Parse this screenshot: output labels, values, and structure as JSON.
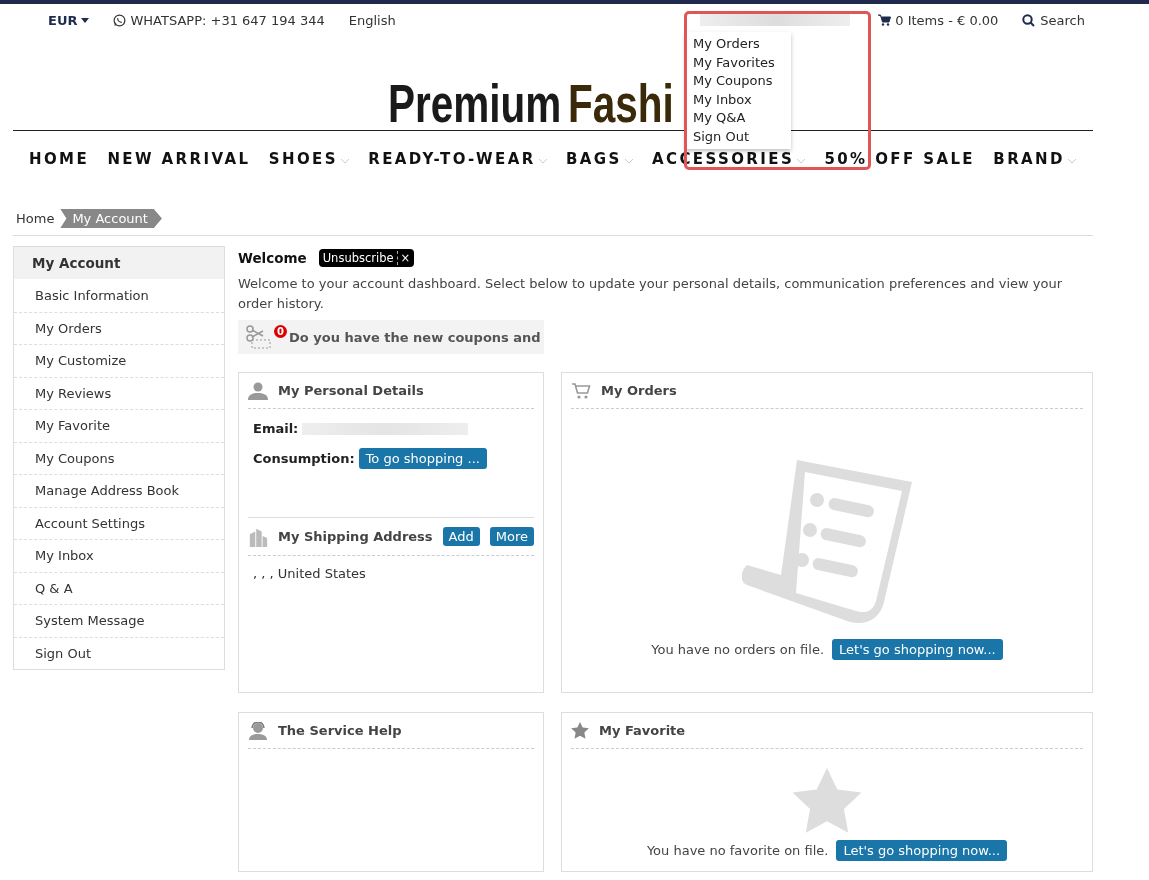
{
  "topbar": {
    "currency": "EUR",
    "whatsapp": "WHATSAPP: +31 647 194 344",
    "language": "English",
    "cart": "0 Items - € 0.00",
    "search": "Search"
  },
  "account_menu": {
    "items": [
      "My Orders",
      "My Favorites",
      "My Coupons",
      "My Inbox",
      "My Q&A",
      "Sign Out"
    ]
  },
  "logo": {
    "part_1": "Premium",
    "part_2": "Fashi"
  },
  "nav": [
    {
      "label": "HOME",
      "has_menu": false
    },
    {
      "label": "NEW ARRIVAL",
      "has_menu": false
    },
    {
      "label": "SHOES",
      "has_menu": true
    },
    {
      "label": "READY-TO-WEAR",
      "has_menu": true
    },
    {
      "label": "BAGS",
      "has_menu": true
    },
    {
      "label": "ACCESSORIES",
      "has_menu": true
    },
    {
      "label": "50% OFF SALE",
      "has_menu": false
    },
    {
      "label": "BRAND",
      "has_menu": true
    }
  ],
  "breadcrumb": [
    "Home",
    "My Account"
  ],
  "sidebar": {
    "title": "My Account",
    "items": [
      "Basic Information",
      "My Orders",
      "My Customize",
      "My Reviews",
      "My Favorite",
      "My Coupons",
      "Manage Address Book",
      "Account Settings",
      "My Inbox",
      "Q & A",
      "System Message",
      "Sign Out"
    ]
  },
  "welcome": {
    "title": "Welcome",
    "unsubscribe": "Unsubscribe",
    "close": "×",
    "text": "Welcome to your account dashboard. Select below to update your personal details, communication preferences and view your order history."
  },
  "coupon": {
    "count": "0",
    "text": "Do you have the new coupons and"
  },
  "personal": {
    "title": "My Personal Details",
    "email_label": "Email:",
    "consumption_label": "Consumption:",
    "consumption_button": "To go shopping ..."
  },
  "shipping": {
    "title": "My Shipping Address",
    "add": "Add",
    "more": "More",
    "address": ", , , United States"
  },
  "orders": {
    "title": "My Orders",
    "empty": "You have no orders on file.",
    "button": "Let's go shopping now..."
  },
  "service": {
    "title": "The Service Help"
  },
  "favorite": {
    "title": "My Favorite",
    "empty": "You have no favorite on file.",
    "button": "Let's go shopping now..."
  }
}
